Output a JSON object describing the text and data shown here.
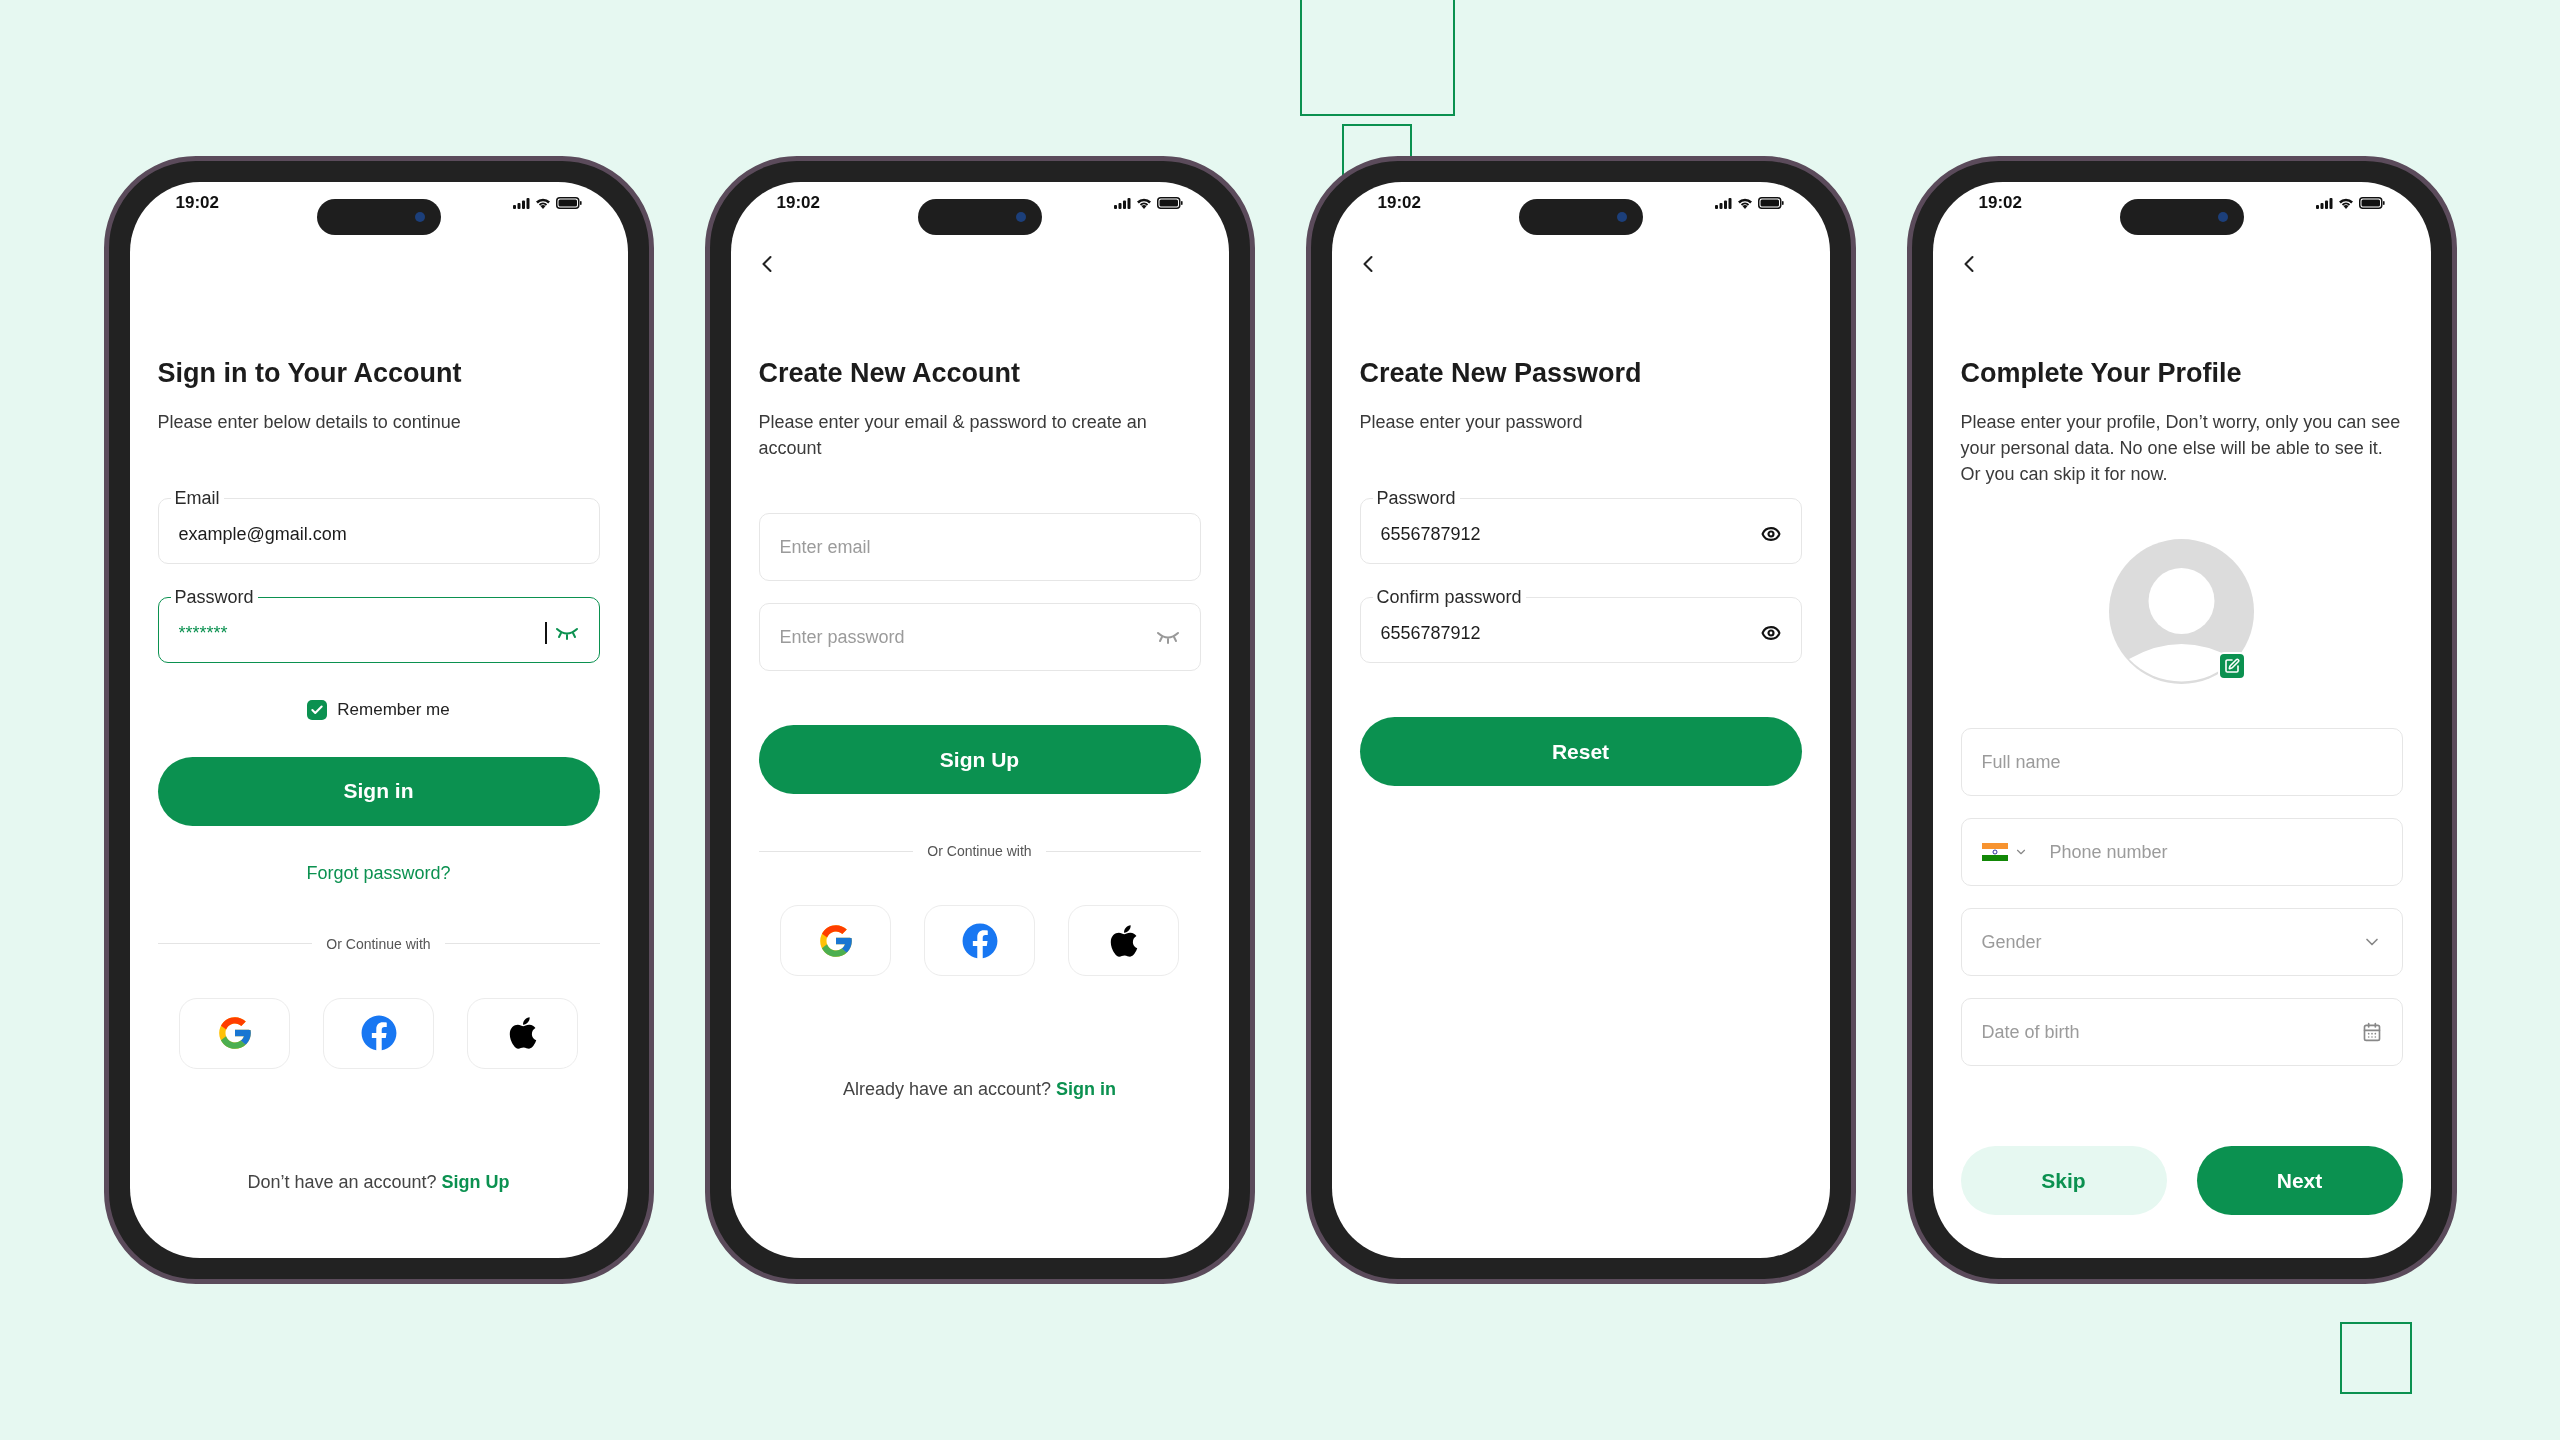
{
  "phones": [
    {
      "time": "19:02",
      "back": false,
      "title": "Sign in to Your Account",
      "subtitle": "Please enter below details to continue",
      "items": [
        {
          "kind": "email",
          "label": "Email",
          "value": "example@gmail.com",
          "focused": false
        },
        {
          "kind": "password",
          "label": "Password",
          "value": "*******",
          "focused": true,
          "masked": true
        },
        {
          "kind": "checkbox",
          "label": "Remember me",
          "checked": true
        },
        {
          "kind": "button",
          "label": "Sign in"
        },
        {
          "kind": "link",
          "label": "Forgot password?"
        },
        {
          "kind": "divider",
          "label": "Or Continue with"
        },
        {
          "kind": "social"
        },
        {
          "kind": "footer",
          "text": "Don’t have an account?",
          "link": "Sign Up"
        }
      ]
    },
    {
      "time": "19:02",
      "back": true,
      "title": "Create New Account",
      "subtitle": "Please enter your email & password to create an account",
      "items": [
        {
          "kind": "email",
          "placeholder": "Enter email",
          "focused": false
        },
        {
          "kind": "password",
          "placeholder": "Enter password",
          "focused": false,
          "masked": true
        },
        {
          "kind": "button",
          "label": "Sign Up"
        },
        {
          "kind": "divider",
          "label": "Or Continue with"
        },
        {
          "kind": "social"
        },
        {
          "kind": "footer",
          "text": "Already have an account?",
          "link": "Sign in"
        }
      ]
    },
    {
      "time": "19:02",
      "back": true,
      "title": "Create New Password",
      "subtitle": "Please enter your password",
      "items": [
        {
          "kind": "password",
          "label": "Password",
          "value": "6556787912",
          "focused": false,
          "masked": false
        },
        {
          "kind": "password",
          "label": "Confirm password",
          "value": "6556787912",
          "focused": false,
          "masked": false
        },
        {
          "kind": "button",
          "label": "Reset"
        }
      ]
    },
    {
      "time": "19:02",
      "back": true,
      "title": "Complete Your Profile",
      "subtitle": "Please enter your profile, Don’t worry, only you can see your personal data. No one else will be able to see it. Or you can skip it for now.",
      "items": [
        {
          "kind": "avatar"
        },
        {
          "kind": "text",
          "placeholder": "Full name",
          "focused": false
        },
        {
          "kind": "phone",
          "placeholder": "Phone number",
          "focused": false
        },
        {
          "kind": "select",
          "placeholder": "Gender",
          "focused": false
        },
        {
          "kind": "date",
          "placeholder": "Date of birth",
          "focused": false
        },
        {
          "kind": "button_row",
          "buttons": [
            {
              "kind": "secondary",
              "label": "Skip"
            },
            {
              "kind": "primary",
              "label": "Next"
            }
          ]
        }
      ]
    }
  ]
}
